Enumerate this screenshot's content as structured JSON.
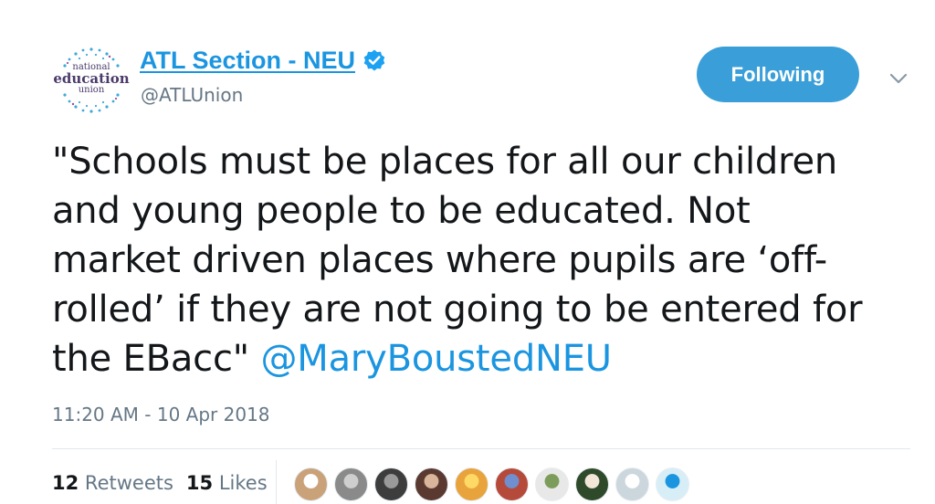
{
  "author": {
    "display_name": "ATL Section - NEU",
    "handle": "@ATLUnion",
    "avatar_text": [
      "national",
      "education",
      "union"
    ],
    "verified": true
  },
  "follow_button": {
    "label": "Following"
  },
  "tweet": {
    "lines": [
      "\"Schools must be places for all our children",
      "and young people to be educated. Not",
      "market driven places where pupils are ‘off-",
      "rolled’ if they are not going to be entered for",
      "the EBacc\" "
    ],
    "mention": "@MaryBoustedNEU",
    "timestamp": "11:20 AM - 10 Apr 2018"
  },
  "stats": {
    "retweets_count": "12",
    "retweets_label": "Retweets",
    "likes_count": "15",
    "likes_label": "Likes"
  },
  "likers": [
    {
      "name": "liker-1",
      "color": "#c9a27a"
    },
    {
      "name": "liker-2",
      "color": "#8a8a8a"
    },
    {
      "name": "liker-3",
      "color": "#3d3d3d"
    },
    {
      "name": "liker-4",
      "color": "#5a3a30"
    },
    {
      "name": "liker-5",
      "color": "#e8a33c"
    },
    {
      "name": "liker-6",
      "color": "#b64a3a"
    },
    {
      "name": "liker-7",
      "color": "#e8e8e8"
    },
    {
      "name": "liker-8",
      "color": "#2f4a2a"
    },
    {
      "name": "liker-9",
      "color": "#ccd6dd"
    },
    {
      "name": "liker-10",
      "color": "#d8eef7"
    }
  ],
  "colors": {
    "link": "#1b95e0",
    "button": "#3a9fd9",
    "muted": "#657786"
  }
}
